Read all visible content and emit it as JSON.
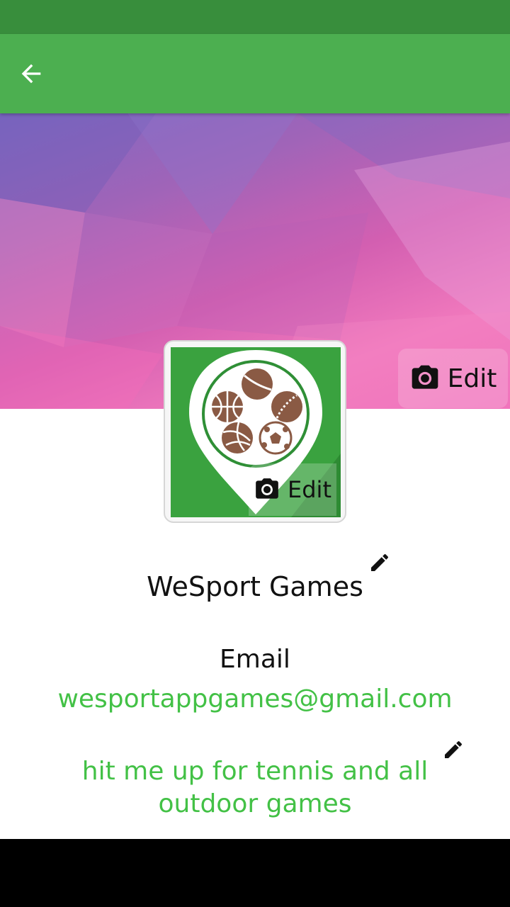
{
  "colors": {
    "status_bar": "#388e3c",
    "app_bar": "#4caf50",
    "accent_text": "#43c146"
  },
  "app_bar": {
    "back_icon": "arrow-back-icon"
  },
  "cover": {
    "edit_label": "Edit",
    "edit_icon": "camera-icon"
  },
  "avatar": {
    "edit_label": "Edit",
    "edit_icon": "camera-icon"
  },
  "profile": {
    "name": "WeSport Games",
    "name_edit_icon": "pencil-icon",
    "email_label": "Email",
    "email": "wesportappgames@gmail.com",
    "bio": "hit me up for tennis and all outdoor games",
    "bio_edit_icon": "pencil-icon"
  }
}
